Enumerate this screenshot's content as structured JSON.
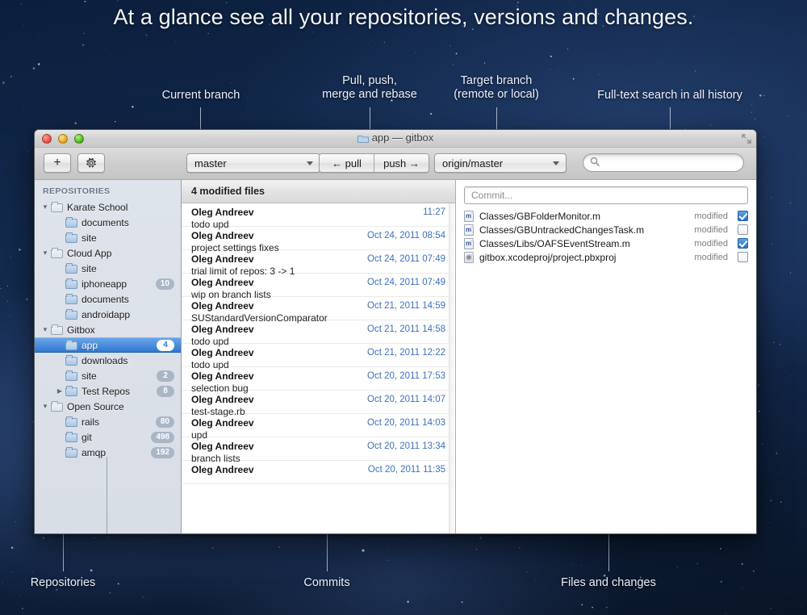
{
  "headline": "At a glance see all your repositories, versions and changes.",
  "annotations": [
    {
      "text": "Current branch",
      "name": "annotation-current-branch"
    },
    {
      "text": "Pull, push,\nmerge and rebase",
      "name": "annotation-pull-push"
    },
    {
      "text": "Target branch\n(remote or local)",
      "name": "annotation-target-branch"
    },
    {
      "text": "Full-text search in all history",
      "name": "annotation-search"
    },
    {
      "text": "Repositories",
      "name": "annotation-repositories"
    },
    {
      "text": "Commits",
      "name": "annotation-commits"
    },
    {
      "text": "Files and changes",
      "name": "annotation-files-changes"
    }
  ],
  "window": {
    "title": "app — gitbox",
    "toolbar": {
      "add_label": "+",
      "gear_label": "⚙",
      "branch_value": "master",
      "pull_label": "← pull",
      "push_label": "push →",
      "remote_value": "origin/master",
      "search_value": "",
      "search_placeholder": ""
    }
  },
  "sidebar": {
    "header": "REPOSITORIES",
    "items": [
      {
        "label": "Karate School",
        "level": 0,
        "twisty": "open",
        "badge": "",
        "selected": false
      },
      {
        "label": "documents",
        "level": 1,
        "twisty": "none",
        "badge": "",
        "selected": false
      },
      {
        "label": "site",
        "level": 1,
        "twisty": "none",
        "badge": "",
        "selected": false
      },
      {
        "label": "Cloud App",
        "level": 0,
        "twisty": "open",
        "badge": "",
        "selected": false
      },
      {
        "label": "site",
        "level": 1,
        "twisty": "none",
        "badge": "",
        "selected": false
      },
      {
        "label": "iphoneapp",
        "level": 1,
        "twisty": "none",
        "badge": "10",
        "selected": false
      },
      {
        "label": "documents",
        "level": 1,
        "twisty": "none",
        "badge": "",
        "selected": false
      },
      {
        "label": "androidapp",
        "level": 1,
        "twisty": "none",
        "badge": "",
        "selected": false
      },
      {
        "label": "Gitbox",
        "level": 0,
        "twisty": "open",
        "badge": "",
        "selected": false
      },
      {
        "label": "app",
        "level": 1,
        "twisty": "none",
        "badge": "4",
        "selected": true
      },
      {
        "label": "downloads",
        "level": 1,
        "twisty": "none",
        "badge": "",
        "selected": false
      },
      {
        "label": "site",
        "level": 1,
        "twisty": "none",
        "badge": "2",
        "selected": false
      },
      {
        "label": "Test Repos",
        "level": 1,
        "twisty": "closed",
        "badge": "8",
        "selected": false
      },
      {
        "label": "Open Source",
        "level": 0,
        "twisty": "open",
        "badge": "",
        "selected": false
      },
      {
        "label": "rails",
        "level": 1,
        "twisty": "none",
        "badge": "80",
        "selected": false
      },
      {
        "label": "git",
        "level": 1,
        "twisty": "none",
        "badge": "498",
        "selected": false
      },
      {
        "label": "amqp",
        "level": 1,
        "twisty": "none",
        "badge": "192",
        "selected": false
      }
    ]
  },
  "commits": {
    "header": "4 modified files",
    "rows": [
      {
        "author": "Oleg Andreev",
        "message": "todo upd",
        "date": "11:27"
      },
      {
        "author": "Oleg Andreev",
        "message": "project settings fixes",
        "date": "Oct 24, 2011 08:54"
      },
      {
        "author": "Oleg Andreev",
        "message": "trial limit of repos: 3 -> 1",
        "date": "Oct 24, 2011 07:49"
      },
      {
        "author": "Oleg Andreev",
        "message": "wip on branch lists",
        "date": "Oct 24, 2011 07:49"
      },
      {
        "author": "Oleg Andreev",
        "message": "SUStandardVersionComparator",
        "date": "Oct 21, 2011 14:59"
      },
      {
        "author": "Oleg Andreev",
        "message": "todo upd",
        "date": "Oct 21, 2011 14:58"
      },
      {
        "author": "Oleg Andreev",
        "message": "todo upd",
        "date": "Oct 21, 2011 12:22"
      },
      {
        "author": "Oleg Andreev",
        "message": "selection bug",
        "date": "Oct 20, 2011 17:53"
      },
      {
        "author": "Oleg Andreev",
        "message": "test-stage.rb",
        "date": "Oct 20, 2011 14:07"
      },
      {
        "author": "Oleg Andreev",
        "message": "upd",
        "date": "Oct 20, 2011 14:03"
      },
      {
        "author": "Oleg Andreev",
        "message": "branch lists",
        "date": "Oct 20, 2011 13:34"
      },
      {
        "author": "Oleg Andreev",
        "message": "",
        "date": "Oct 20, 2011 11:35"
      }
    ]
  },
  "files": {
    "commit_placeholder": "Commit...",
    "commit_value": "",
    "rows": [
      {
        "icon": "source-file-icon",
        "path": "Classes/GBFolderMonitor.m",
        "status": "modified",
        "checked": true
      },
      {
        "icon": "source-file-icon",
        "path": "Classes/GBUntrackedChangesTask.m",
        "status": "modified",
        "checked": false
      },
      {
        "icon": "source-file-icon",
        "path": "Classes/Libs/OAFSEventStream.m",
        "status": "modified",
        "checked": true
      },
      {
        "icon": "xcodeproj-icon",
        "path": "gitbox.xcodeproj/project.pbxproj",
        "status": "modified",
        "checked": false
      }
    ]
  },
  "colors": {
    "accent_blue": "#2f78cf",
    "date_blue": "#3d6fc0",
    "badge_gray": "#a9b6c6",
    "background_deep": "#0b1e3c"
  }
}
